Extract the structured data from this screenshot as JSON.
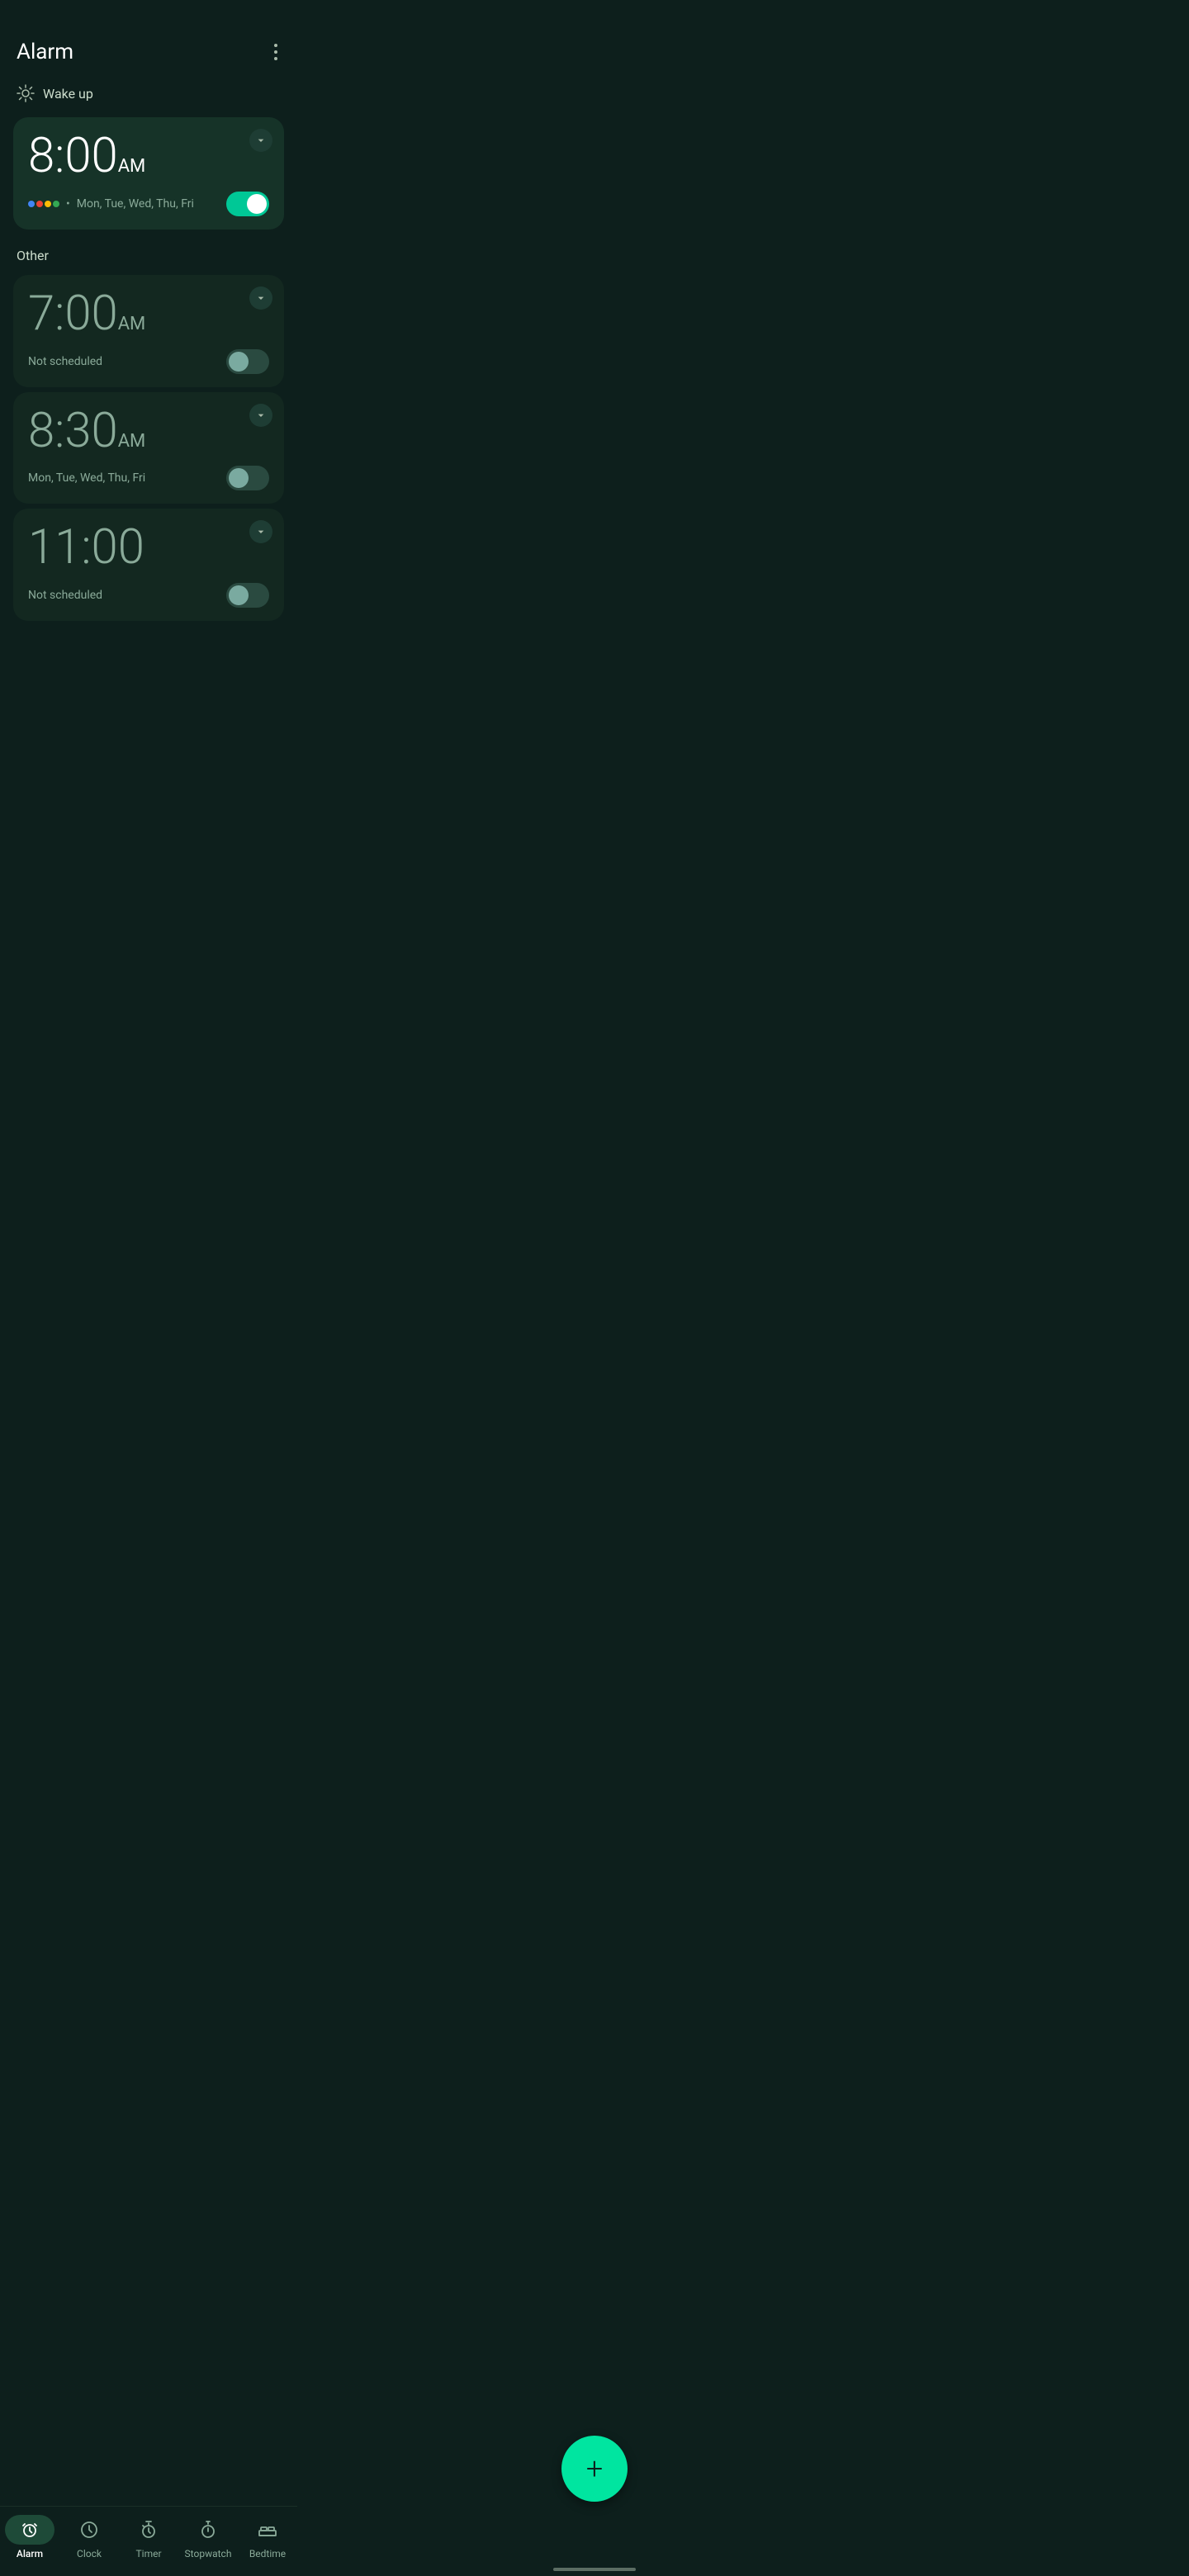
{
  "header": {
    "title": "Alarm",
    "menu_label": "More options"
  },
  "wake_up_section": {
    "label": "Wake up",
    "alarm": {
      "time": "8:00",
      "ampm": "AM",
      "schedule": "Mon, Tue, Wed, Thu, Fri",
      "active": true,
      "has_google": true
    }
  },
  "other_section": {
    "label": "Other",
    "alarms": [
      {
        "time": "7:00",
        "ampm": "AM",
        "schedule": "Not scheduled",
        "active": false
      },
      {
        "time": "8:30",
        "ampm": "AM",
        "schedule": "Mon, Tue, Wed, Thu, Fri",
        "active": false
      },
      {
        "time": "11:00",
        "ampm": "",
        "schedule": "Not scheduled",
        "active": false
      }
    ]
  },
  "fab": {
    "label": "Add alarm",
    "icon": "+"
  },
  "nav": {
    "items": [
      {
        "id": "alarm",
        "label": "Alarm",
        "active": true
      },
      {
        "id": "clock",
        "label": "Clock",
        "active": false
      },
      {
        "id": "timer",
        "label": "Timer",
        "active": false
      },
      {
        "id": "stopwatch",
        "label": "Stopwatch",
        "active": false
      },
      {
        "id": "bedtime",
        "label": "Bedtime",
        "active": false
      }
    ]
  }
}
